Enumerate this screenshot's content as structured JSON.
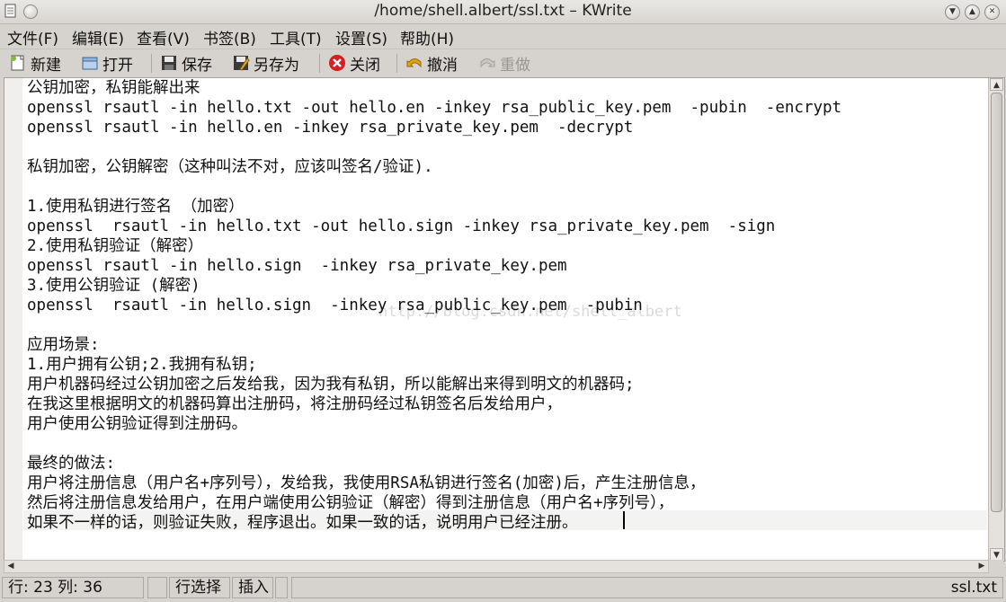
{
  "window": {
    "title": "/home/shell.albert/ssl.txt – KWrite"
  },
  "menu": [
    "文件(F)",
    "编辑(E)",
    "查看(V)",
    "书签(B)",
    "工具(T)",
    "设置(S)",
    "帮助(H)"
  ],
  "toolbar": {
    "new": "新建",
    "open": "打开",
    "save": "保存",
    "save_as": "另存为",
    "close": "关闭",
    "undo": "撤消",
    "redo": "重做"
  },
  "editor": {
    "lines": [
      "公钥加密，私钥能解出来",
      "openssl rsautl -in hello.txt -out hello.en -inkey rsa_public_key.pem  -pubin  -encrypt",
      "openssl rsautl -in hello.en -inkey rsa_private_key.pem  -decrypt",
      "",
      "私钥加密，公钥解密（这种叫法不对，应该叫签名/验证).",
      "",
      "1.使用私钥进行签名 （加密）",
      "openssl  rsautl -in hello.txt -out hello.sign -inkey rsa_private_key.pem  -sign",
      "2.使用私钥验证（解密）",
      "openssl rsautl -in hello.sign  -inkey rsa_private_key.pem",
      "3.使用公钥验证 (解密)",
      "openssl  rsautl -in hello.sign  -inkey rsa_public_key.pem  -pubin",
      "",
      "应用场景:",
      "1.用户拥有公钥;2.我拥有私钥;",
      "用户机器码经过公钥加密之后发给我，因为我有私钥，所以能解出来得到明文的机器码;",
      "在我这里根据明文的机器码算出注册码，将注册码经过私钥签名后发给用户，",
      "用户使用公钥验证得到注册码。",
      "",
      "最终的做法:",
      "用户将注册信息（用户名+序列号），发给我，我使用RSA私钥进行签名(加密)后，产生注册信息，",
      "然后将注册信息发给用户，在用户端使用公钥验证（解密）得到注册信息（用户名+序列号），",
      "如果不一样的话，则验证失败，程序退出。如果一致的话，说明用户已经注册。"
    ],
    "watermark": "http://blog.csdn.net/shell_albert"
  },
  "status": {
    "position": "行: 23 列: 36",
    "line_select": "行选择",
    "mode": "插入",
    "filename": "ssl.txt"
  },
  "colors": {
    "background": "#d6d2cd",
    "editor_bg": "#ffffff",
    "undo_icon": "#e0a21e",
    "close_icon": "#d42020"
  }
}
